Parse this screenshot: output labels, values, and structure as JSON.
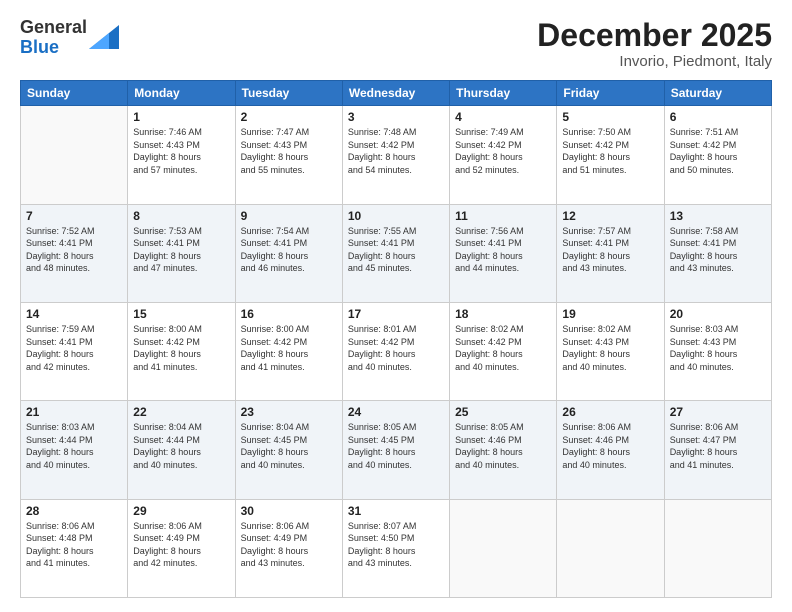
{
  "logo": {
    "general": "General",
    "blue": "Blue"
  },
  "title": {
    "month_year": "December 2025",
    "location": "Invorio, Piedmont, Italy"
  },
  "weekdays": [
    "Sunday",
    "Monday",
    "Tuesday",
    "Wednesday",
    "Thursday",
    "Friday",
    "Saturday"
  ],
  "weeks": [
    [
      {
        "day": "",
        "info": ""
      },
      {
        "day": "1",
        "info": "Sunrise: 7:46 AM\nSunset: 4:43 PM\nDaylight: 8 hours\nand 57 minutes."
      },
      {
        "day": "2",
        "info": "Sunrise: 7:47 AM\nSunset: 4:43 PM\nDaylight: 8 hours\nand 55 minutes."
      },
      {
        "day": "3",
        "info": "Sunrise: 7:48 AM\nSunset: 4:42 PM\nDaylight: 8 hours\nand 54 minutes."
      },
      {
        "day": "4",
        "info": "Sunrise: 7:49 AM\nSunset: 4:42 PM\nDaylight: 8 hours\nand 52 minutes."
      },
      {
        "day": "5",
        "info": "Sunrise: 7:50 AM\nSunset: 4:42 PM\nDaylight: 8 hours\nand 51 minutes."
      },
      {
        "day": "6",
        "info": "Sunrise: 7:51 AM\nSunset: 4:42 PM\nDaylight: 8 hours\nand 50 minutes."
      }
    ],
    [
      {
        "day": "7",
        "info": "Sunrise: 7:52 AM\nSunset: 4:41 PM\nDaylight: 8 hours\nand 48 minutes."
      },
      {
        "day": "8",
        "info": "Sunrise: 7:53 AM\nSunset: 4:41 PM\nDaylight: 8 hours\nand 47 minutes."
      },
      {
        "day": "9",
        "info": "Sunrise: 7:54 AM\nSunset: 4:41 PM\nDaylight: 8 hours\nand 46 minutes."
      },
      {
        "day": "10",
        "info": "Sunrise: 7:55 AM\nSunset: 4:41 PM\nDaylight: 8 hours\nand 45 minutes."
      },
      {
        "day": "11",
        "info": "Sunrise: 7:56 AM\nSunset: 4:41 PM\nDaylight: 8 hours\nand 44 minutes."
      },
      {
        "day": "12",
        "info": "Sunrise: 7:57 AM\nSunset: 4:41 PM\nDaylight: 8 hours\nand 43 minutes."
      },
      {
        "day": "13",
        "info": "Sunrise: 7:58 AM\nSunset: 4:41 PM\nDaylight: 8 hours\nand 43 minutes."
      }
    ],
    [
      {
        "day": "14",
        "info": "Sunrise: 7:59 AM\nSunset: 4:41 PM\nDaylight: 8 hours\nand 42 minutes."
      },
      {
        "day": "15",
        "info": "Sunrise: 8:00 AM\nSunset: 4:42 PM\nDaylight: 8 hours\nand 41 minutes."
      },
      {
        "day": "16",
        "info": "Sunrise: 8:00 AM\nSunset: 4:42 PM\nDaylight: 8 hours\nand 41 minutes."
      },
      {
        "day": "17",
        "info": "Sunrise: 8:01 AM\nSunset: 4:42 PM\nDaylight: 8 hours\nand 40 minutes."
      },
      {
        "day": "18",
        "info": "Sunrise: 8:02 AM\nSunset: 4:42 PM\nDaylight: 8 hours\nand 40 minutes."
      },
      {
        "day": "19",
        "info": "Sunrise: 8:02 AM\nSunset: 4:43 PM\nDaylight: 8 hours\nand 40 minutes."
      },
      {
        "day": "20",
        "info": "Sunrise: 8:03 AM\nSunset: 4:43 PM\nDaylight: 8 hours\nand 40 minutes."
      }
    ],
    [
      {
        "day": "21",
        "info": "Sunrise: 8:03 AM\nSunset: 4:44 PM\nDaylight: 8 hours\nand 40 minutes."
      },
      {
        "day": "22",
        "info": "Sunrise: 8:04 AM\nSunset: 4:44 PM\nDaylight: 8 hours\nand 40 minutes."
      },
      {
        "day": "23",
        "info": "Sunrise: 8:04 AM\nSunset: 4:45 PM\nDaylight: 8 hours\nand 40 minutes."
      },
      {
        "day": "24",
        "info": "Sunrise: 8:05 AM\nSunset: 4:45 PM\nDaylight: 8 hours\nand 40 minutes."
      },
      {
        "day": "25",
        "info": "Sunrise: 8:05 AM\nSunset: 4:46 PM\nDaylight: 8 hours\nand 40 minutes."
      },
      {
        "day": "26",
        "info": "Sunrise: 8:06 AM\nSunset: 4:46 PM\nDaylight: 8 hours\nand 40 minutes."
      },
      {
        "day": "27",
        "info": "Sunrise: 8:06 AM\nSunset: 4:47 PM\nDaylight: 8 hours\nand 41 minutes."
      }
    ],
    [
      {
        "day": "28",
        "info": "Sunrise: 8:06 AM\nSunset: 4:48 PM\nDaylight: 8 hours\nand 41 minutes."
      },
      {
        "day": "29",
        "info": "Sunrise: 8:06 AM\nSunset: 4:49 PM\nDaylight: 8 hours\nand 42 minutes."
      },
      {
        "day": "30",
        "info": "Sunrise: 8:06 AM\nSunset: 4:49 PM\nDaylight: 8 hours\nand 43 minutes."
      },
      {
        "day": "31",
        "info": "Sunrise: 8:07 AM\nSunset: 4:50 PM\nDaylight: 8 hours\nand 43 minutes."
      },
      {
        "day": "",
        "info": ""
      },
      {
        "day": "",
        "info": ""
      },
      {
        "day": "",
        "info": ""
      }
    ]
  ]
}
